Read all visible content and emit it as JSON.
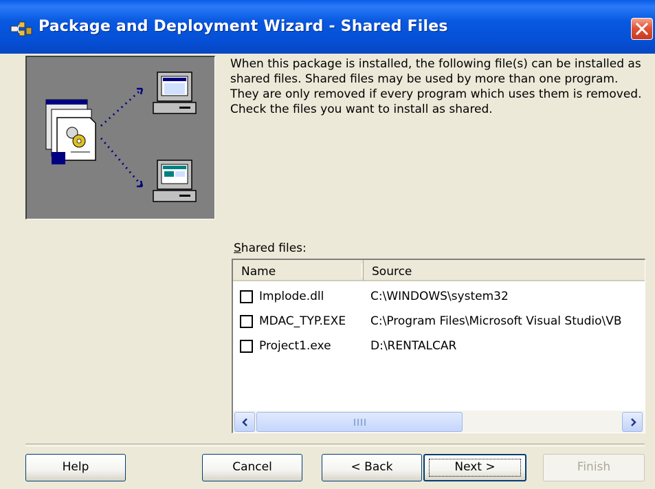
{
  "window": {
    "title": "Package and Deployment Wizard - Shared Files",
    "icons": {
      "app": "package-deployment-icon",
      "close": "close-x-icon"
    }
  },
  "description": "When this package is installed, the following file(s) can be installed as shared files. Shared files may be used by more than one program. They are only removed if every program which uses them is removed. Check the files you want to install as shared.",
  "shared_files": {
    "label_accel": "S",
    "label_rest": "hared files:",
    "columns": {
      "name": "Name",
      "source": "Source"
    },
    "rows": [
      {
        "name": "Implode.dll",
        "source": "C:\\WINDOWS\\system32",
        "checked": false
      },
      {
        "name": "MDAC_TYP.EXE",
        "source": "C:\\Program Files\\Microsoft Visual Studio\\VB",
        "checked": false
      },
      {
        "name": "Project1.exe",
        "source": "D:\\RENTALCAR",
        "checked": false
      }
    ]
  },
  "buttons": {
    "help": "Help",
    "cancel": "Cancel",
    "back": "< Back",
    "next": "Next >",
    "finish": "Finish"
  },
  "colors": {
    "titlebar": "#0553d8",
    "dialog_bg": "#ece9d8",
    "illustration_bg": "#808080",
    "close_button": "#e2533a"
  }
}
